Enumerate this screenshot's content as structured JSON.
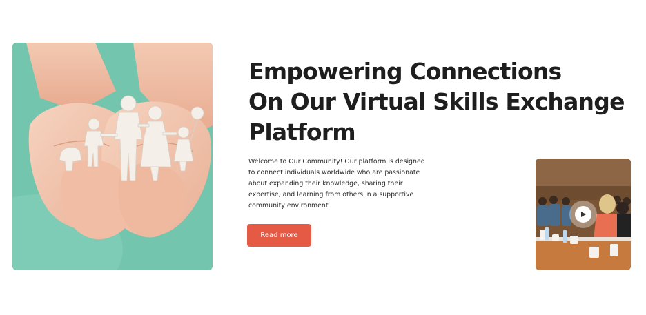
{
  "hero": {
    "headline_lines": [
      "Empowering Connections",
      "On Our Virtual Skills Exchange",
      "Platform"
    ],
    "description": "Welcome to Our Community! Our platform is designed to connect individuals worldwide who are passionate about expanding their knowledge, sharing their expertise, and learning from others in a supportive community environment",
    "cta_label": "Read more"
  },
  "media": {
    "main_image": "hands-holding-paper-family",
    "video_thumbnail": "conference-audience",
    "video_icon": "play-icon"
  },
  "colors": {
    "accent": "#e45a45",
    "heading": "#1e1e1e",
    "body_text": "#2b2b2b",
    "image_background": "#7fcab4"
  }
}
